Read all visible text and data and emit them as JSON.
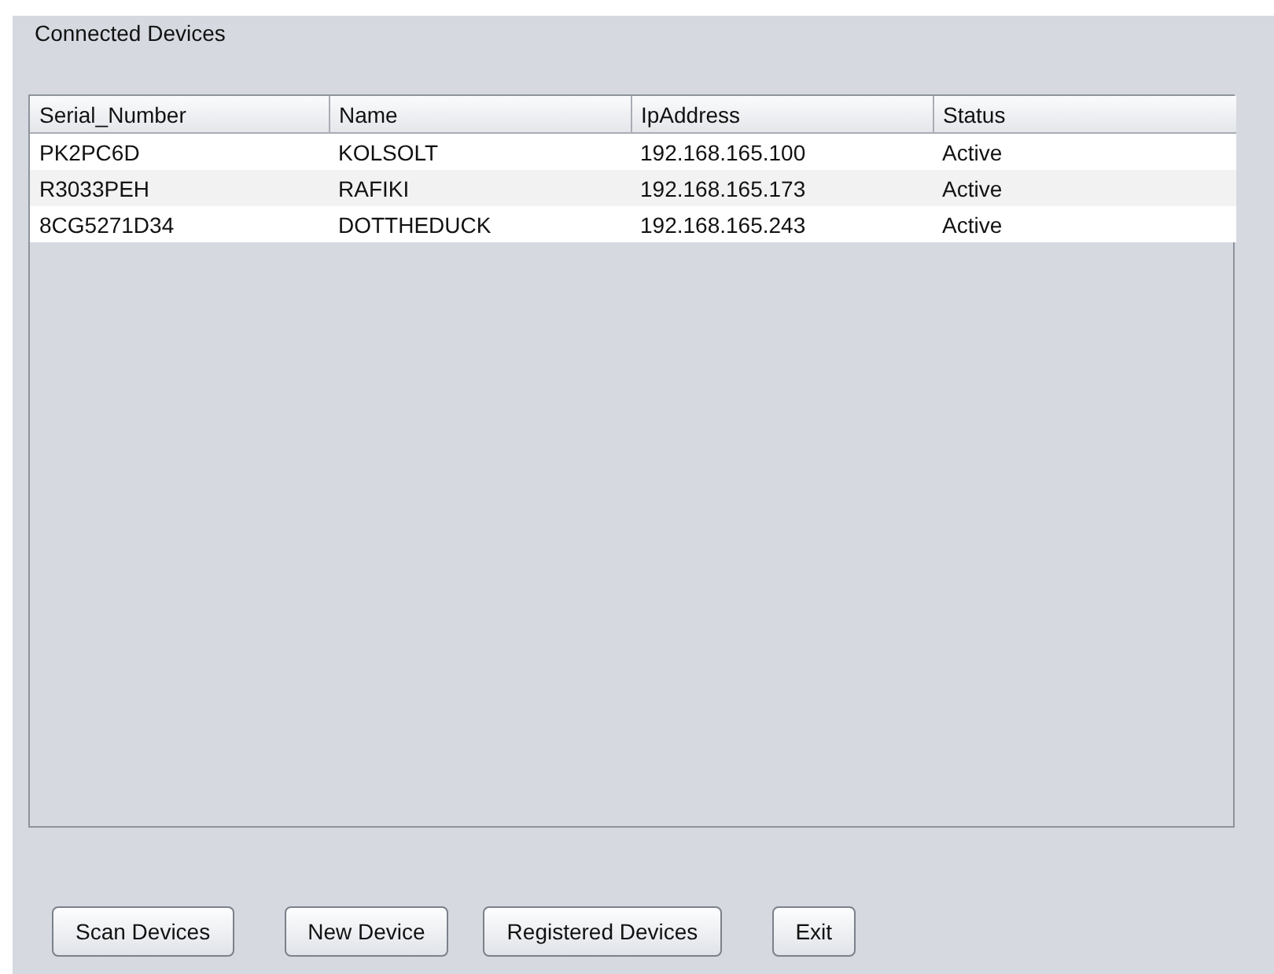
{
  "panel": {
    "title": "Connected Devices"
  },
  "table": {
    "columns": [
      "Serial_Number",
      "Name",
      "IpAddress",
      "Status"
    ],
    "rows": [
      [
        "PK2PC6D",
        "KOLSOLT",
        "192.168.165.100",
        "Active"
      ],
      [
        "R3033PEH",
        "RAFIKI",
        "192.168.165.173",
        "Active"
      ],
      [
        "8CG5271D34",
        "DOTTHEDUCK",
        "192.168.165.243",
        "Active"
      ]
    ]
  },
  "buttons": [
    "Scan Devices",
    "New Device",
    "Registered Devices",
    "Exit"
  ]
}
